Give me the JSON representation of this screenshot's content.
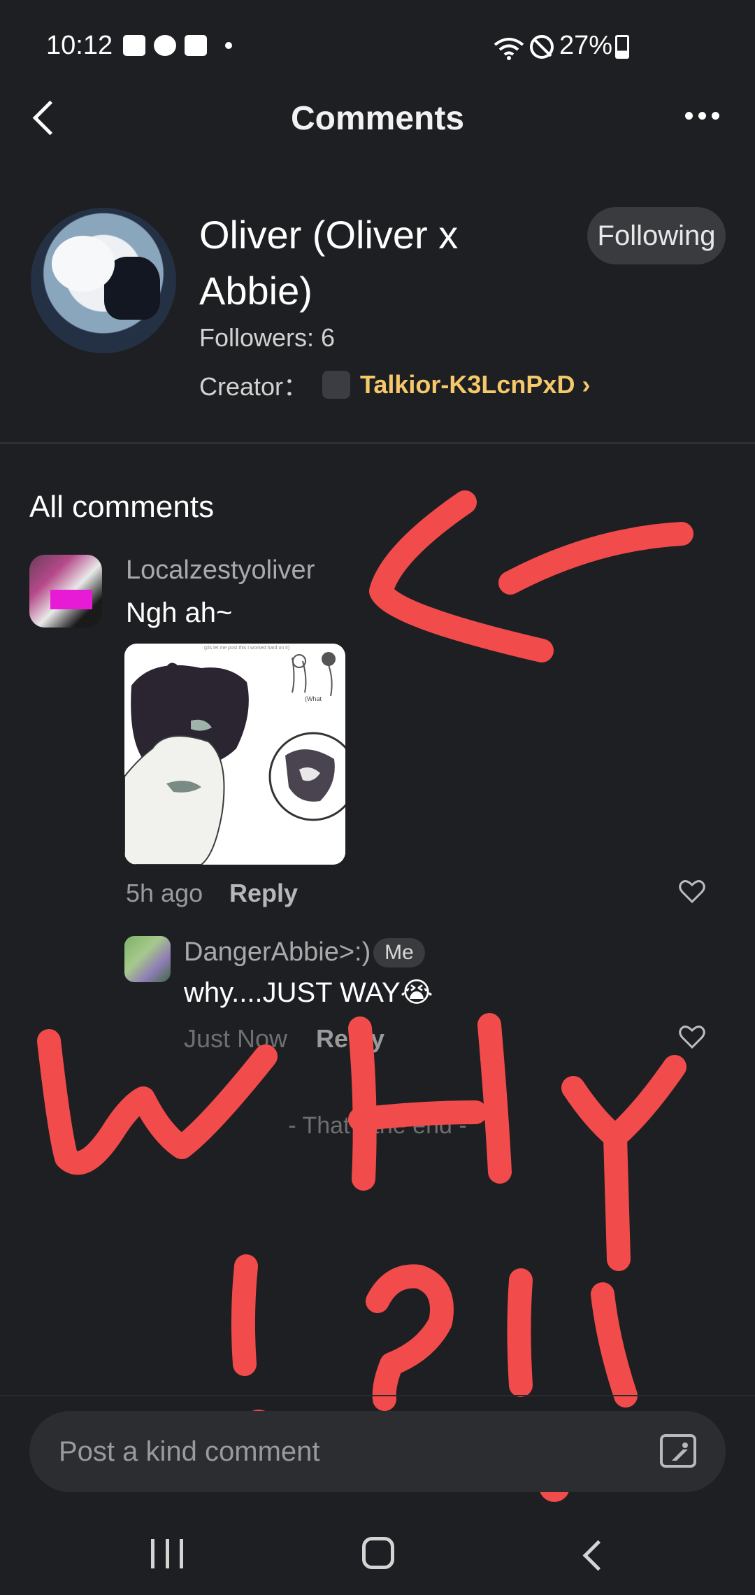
{
  "status_bar": {
    "time": "10:12",
    "battery": "27%"
  },
  "header": {
    "title": "Comments"
  },
  "profile": {
    "name": "Oliver (Oliver x Abbie)",
    "following_label": "Following",
    "followers": "Followers: 6",
    "creator_label": "Creator：",
    "creator_name": "Talkior-K3LcnPxD",
    "creator_chevron": "›"
  },
  "comments": {
    "section_title": "All comments",
    "items": [
      {
        "user": "Localzestyoliver",
        "text": "Ngh ah~",
        "time": "5h ago",
        "reply_label": "Reply",
        "image_caption": "(pls let me post this I worked hard on it)"
      },
      {
        "user": "DangerAbbie>:)",
        "badge": "Me",
        "text": "why....JUST WAY😭",
        "time": "Just Now",
        "reply_label": "Reply"
      }
    ],
    "end_text": "- That's the end -"
  },
  "composer": {
    "placeholder": "Post a kind comment"
  },
  "overlay": {
    "scribble_text": "<-  WHY !?!!",
    "color": "#f24b4b"
  }
}
